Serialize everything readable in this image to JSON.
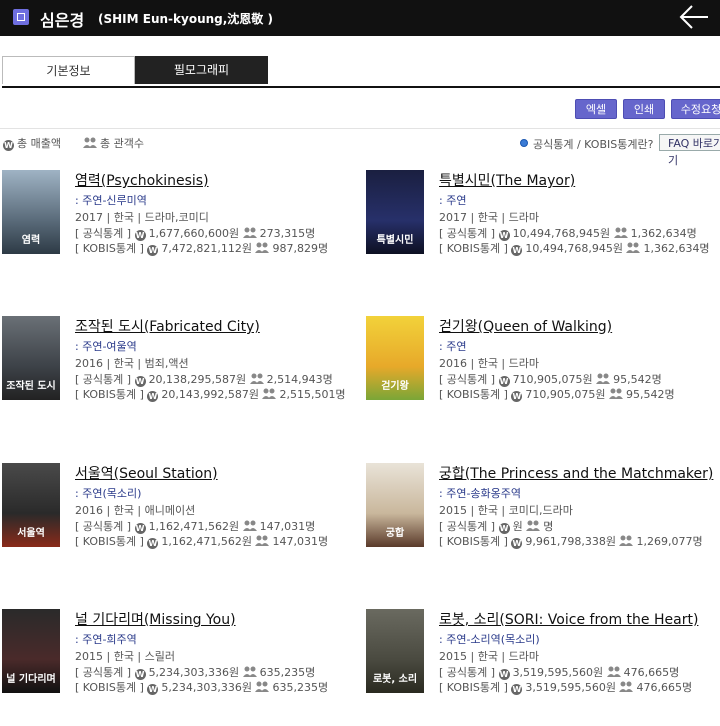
{
  "header": {
    "name": "심은경",
    "eng_name": "(SHIM Eun-kyoung,沈恩敬 )"
  },
  "tabs": [
    {
      "label": "기본정보"
    },
    {
      "label": "필모그래피"
    }
  ],
  "actions": {
    "excel": "엑셀",
    "print": "인쇄",
    "edit": "수정요청"
  },
  "legend": {
    "sales": "총 매출액",
    "audience": "총 관객수"
  },
  "stats_link": "공식통계 / KOBIS통계란?",
  "faq": "FAQ 바로가기",
  "films": [
    {
      "title": "염력(Psychokinesis)",
      "role": ": 주연-신루미역",
      "meta": "2017 | 한국 | 드라마,코미디",
      "official_label": "[ 공식통계 ]",
      "official_sales": "1,677,660,600원",
      "official_aud": "273,315명",
      "kobis_label": "[ KOBIS통계 ]",
      "kobis_sales": "7,472,821,112원",
      "kobis_aud": "987,829명",
      "poster_text": "염력"
    },
    {
      "title": "특별시민(The Mayor)",
      "role": ": 주연",
      "meta": "2017 | 한국 | 드라마",
      "official_label": "[ 공식통계 ]",
      "official_sales": "10,494,768,945원",
      "official_aud": "1,362,634명",
      "kobis_label": "[ KOBIS통계 ]",
      "kobis_sales": "10,494,768,945원",
      "kobis_aud": "1,362,634명",
      "poster_text": "특별시민"
    },
    {
      "title": "조작된 도시(Fabricated City)",
      "role": ": 주연-여울역",
      "meta": "2016 | 한국 | 범죄,액션",
      "official_label": "[ 공식통계 ]",
      "official_sales": "20,138,295,587원",
      "official_aud": "2,514,943명",
      "kobis_label": "[ KOBIS통계 ]",
      "kobis_sales": "20,143,992,587원",
      "kobis_aud": "2,515,501명",
      "poster_text": "조작된 도시"
    },
    {
      "title": "걷기왕(Queen of Walking)",
      "role": ": 주연",
      "meta": "2016 | 한국 | 드라마",
      "official_label": "[ 공식통계 ]",
      "official_sales": "710,905,075원",
      "official_aud": "95,542명",
      "kobis_label": "[ KOBIS통계 ]",
      "kobis_sales": "710,905,075원",
      "kobis_aud": "95,542명",
      "poster_text": "걷기왕"
    },
    {
      "title": "서울역(Seoul Station)",
      "role": ": 주연(목소리)",
      "meta": "2016 | 한국 | 애니메이션",
      "official_label": "[ 공식통계 ]",
      "official_sales": "1,162,471,562원",
      "official_aud": "147,031명",
      "kobis_label": "[ KOBIS통계 ]",
      "kobis_sales": "1,162,471,562원",
      "kobis_aud": "147,031명",
      "poster_text": "서울역"
    },
    {
      "title": "궁합(The Princess and the Matchmaker)",
      "role": ": 주연-송화옹주역",
      "meta": "2015 | 한국 | 코미디,드라마",
      "official_label": "[ 공식통계 ]",
      "official_sales": "원",
      "official_aud": "명",
      "kobis_label": "[ KOBIS통계 ]",
      "kobis_sales": "9,961,798,338원",
      "kobis_aud": "1,269,077명",
      "poster_text": "궁합"
    },
    {
      "title": "널 기다리며(Missing You)",
      "role": ": 주연-희주역",
      "meta": "2015 | 한국 | 스릴러",
      "official_label": "[ 공식통계 ]",
      "official_sales": "5,234,303,336원",
      "official_aud": "635,235명",
      "kobis_label": "[ KOBIS통계 ]",
      "kobis_sales": "5,234,303,336원",
      "kobis_aud": "635,235명",
      "poster_text": "널 기다리며"
    },
    {
      "title": "로봇, 소리(SORI: Voice from the Heart)",
      "role": ": 주연-소리역(목소리)",
      "meta": "2015 | 한국 | 드라마",
      "official_label": "[ 공식통계 ]",
      "official_sales": "3,519,595,560원",
      "official_aud": "476,665명",
      "kobis_label": "[ KOBIS통계 ]",
      "kobis_sales": "3,519,595,560원",
      "kobis_aud": "476,665명",
      "poster_text": "로봇, 소리"
    }
  ]
}
